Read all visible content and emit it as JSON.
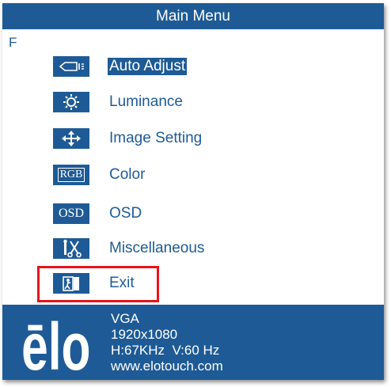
{
  "title": "Main Menu",
  "corner_label": "F",
  "menu": [
    {
      "label": "Auto Adjust",
      "icon": "auto-adjust-icon",
      "selected": true
    },
    {
      "label": "Luminance",
      "icon": "luminance-icon"
    },
    {
      "label": "Image Setting",
      "icon": "image-setting-icon"
    },
    {
      "label": "Color",
      "icon": "rgb-icon",
      "icon_text": "RGB"
    },
    {
      "label": "OSD",
      "icon": "osd-icon",
      "icon_text": "OSD"
    },
    {
      "label": "Miscellaneous",
      "icon": "miscellaneous-icon"
    },
    {
      "label": "Exit",
      "icon": "exit-icon"
    }
  ],
  "footer": {
    "logo": "ēlo",
    "input": "VGA",
    "resolution": "1920x1080",
    "frequency": "H:67KHz  V:60 Hz",
    "website": "www.elotouch.com"
  },
  "colors": {
    "primary": "#1e5b96",
    "highlight": "#e8141c",
    "background": "#ffffff"
  }
}
